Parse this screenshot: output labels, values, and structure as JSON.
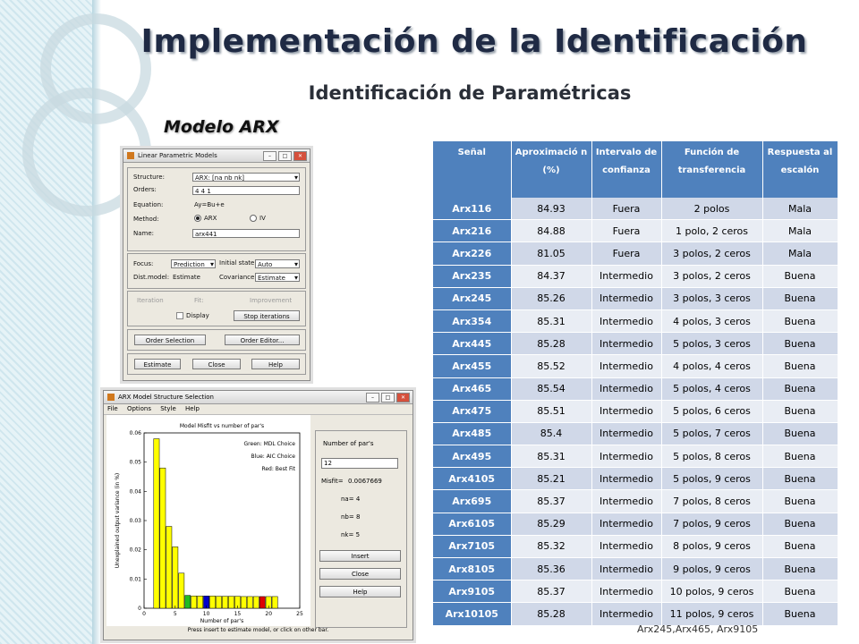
{
  "slide": {
    "title": "Implementación de la Identificación",
    "subtitle": "Identificación de Paramétricas",
    "model_label": "Modelo ARX",
    "caption": "Arx245,Arx465, Arx9105"
  },
  "win1": {
    "title": "Linear Parametric Models",
    "structure_label": "Structure:",
    "structure_value": "ARX: [na nb nk]",
    "orders_label": "Orders:",
    "orders_value": "4 4 1",
    "equation_label": "Equation:",
    "equation_value": "Ay=Bu+e",
    "method_label": "Method:",
    "method_arx": "ARX",
    "method_iv": "IV",
    "name_label": "Name:",
    "name_value": "arx441",
    "focus_label": "Focus:",
    "focus_value": "Prediction",
    "initial_label": "Initial state:",
    "initial_value": "Auto",
    "dist_label": "Dist.model:",
    "dist_value": "Estimate",
    "cov_label": "Covariance:",
    "cov_value": "Estimate",
    "iteration": "Iteration",
    "fit": "Fit:",
    "improvement": "Improvement",
    "display": "Display",
    "stop": "Stop iterations",
    "order_selection": "Order Selection",
    "order_editor": "Order Editor...",
    "estimate": "Estimate",
    "close": "Close",
    "help": "Help"
  },
  "win2": {
    "title": "ARX Model Structure Selection",
    "menu": [
      "File",
      "Options",
      "Style",
      "Help"
    ],
    "number_label": "Number of par's",
    "number_value": "12",
    "misfit_label": "Misfit=",
    "misfit_value": "0.0067669",
    "na": "na= 4",
    "nb": "nb= 8",
    "nk": "nk= 5",
    "insert": "Insert",
    "close": "Close",
    "help": "Help",
    "status": "Press insert to estimate model, or click on other bar."
  },
  "chart_data": {
    "type": "bar",
    "title": "Model Misfit vs number of par's",
    "xlabel": "Number of par's",
    "ylabel": "Unexplained output variance (in %)",
    "xlim": [
      0,
      25
    ],
    "ylim": [
      0,
      0.06
    ],
    "xticks": [
      0,
      5,
      10,
      15,
      20,
      25
    ],
    "yticks": [
      0,
      0.01,
      0.02,
      0.03,
      0.04,
      0.05,
      0.06
    ],
    "legend": [
      "Green: MDL Choice",
      "Blue: AIC Choice",
      "Red: Best Fit"
    ],
    "x": [
      2,
      3,
      4,
      5,
      6,
      7,
      8,
      9,
      10,
      11,
      12,
      13,
      14,
      15,
      16,
      17,
      18,
      19,
      20,
      21
    ],
    "values": [
      0.058,
      0.048,
      0.028,
      0.021,
      0.012,
      0.0044,
      0.0042,
      0.0042,
      0.0042,
      0.0042,
      0.0041,
      0.0041,
      0.0041,
      0.0041,
      0.004,
      0.004,
      0.004,
      0.004,
      0.004,
      0.004
    ],
    "bar_colors": [
      "#ffff00",
      "#ffff00",
      "#ffff00",
      "#ffff00",
      "#ffff00",
      "#22bb22",
      "#ffff00",
      "#ffff00",
      "#0000cc",
      "#ffff00",
      "#ffff00",
      "#ffff00",
      "#ffff00",
      "#ffff00",
      "#ffff00",
      "#ffff00",
      "#ffff00",
      "#dd0000",
      "#ffff00",
      "#ffff00"
    ]
  },
  "table": {
    "headers": [
      "Señal",
      "Aproximació n (%)",
      "Intervalo de confianza",
      "Función de transferencia",
      "Respuesta al escalón"
    ],
    "rows": [
      [
        "Arx116",
        "84.93",
        "Fuera",
        "2 polos",
        "Mala"
      ],
      [
        "Arx216",
        "84.88",
        "Fuera",
        "1 polo, 2 ceros",
        "Mala"
      ],
      [
        "Arx226",
        "81.05",
        "Fuera",
        "3 polos, 2 ceros",
        "Mala"
      ],
      [
        "Arx235",
        "84.37",
        "Intermedio",
        "3 polos, 2 ceros",
        "Buena"
      ],
      [
        "Arx245",
        "85.26",
        "Intermedio",
        "3 polos, 3 ceros",
        "Buena"
      ],
      [
        "Arx354",
        "85.31",
        "Intermedio",
        "4 polos, 3 ceros",
        "Buena"
      ],
      [
        "Arx445",
        "85.28",
        "Intermedio",
        "5 polos, 3 ceros",
        "Buena"
      ],
      [
        "Arx455",
        "85.52",
        "Intermedio",
        "4 polos, 4 ceros",
        "Buena"
      ],
      [
        "Arx465",
        "85.54",
        "Intermedio",
        "5 polos, 4 ceros",
        "Buena"
      ],
      [
        "Arx475",
        "85.51",
        "Intermedio",
        "5 polos, 6 ceros",
        "Buena"
      ],
      [
        "Arx485",
        "85.4",
        "Intermedio",
        "5 polos, 7 ceros",
        "Buena"
      ],
      [
        "Arx495",
        "85.31",
        "Intermedio",
        "5 polos, 8 ceros",
        "Buena"
      ],
      [
        "Arx4105",
        "85.21",
        "Intermedio",
        "5 polos, 9 ceros",
        "Buena"
      ],
      [
        "Arx695",
        "85.37",
        "Intermedio",
        "7 polos, 8 ceros",
        "Buena"
      ],
      [
        "Arx6105",
        "85.29",
        "Intermedio",
        "7 polos, 9 ceros",
        "Buena"
      ],
      [
        "Arx7105",
        "85.32",
        "Intermedio",
        "8 polos, 9 ceros",
        "Buena"
      ],
      [
        "Arx8105",
        "85.36",
        "Intermedio",
        "9 polos, 9 ceros",
        "Buena"
      ],
      [
        "Arx9105",
        "85.37",
        "Intermedio",
        "10 polos, 9 ceros",
        "Buena"
      ],
      [
        "Arx10105",
        "85.28",
        "Intermedio",
        "11 polos, 9 ceros",
        "Buena"
      ]
    ]
  }
}
